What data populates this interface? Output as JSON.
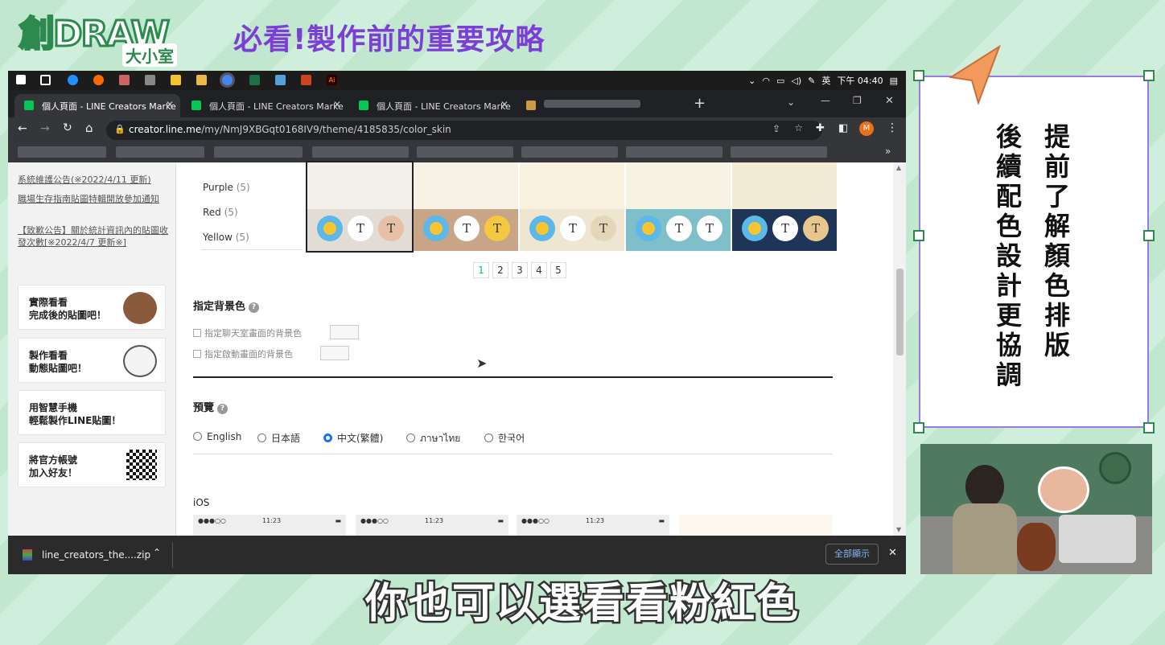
{
  "brand": {
    "logo_main": "創DRAW",
    "logo_sub": "大小室"
  },
  "headline": "必看!製作前的重要攻略",
  "taskbar": {
    "ime": "英",
    "clock": "下午 04:40",
    "app_label": "Ai"
  },
  "tabs": [
    {
      "label": "個人頁面 - LINE Creators Marke"
    },
    {
      "label": "個人頁面 - LINE Creators Marke"
    },
    {
      "label": "個人頁面 - LINE Creators Marke"
    }
  ],
  "addressbar": {
    "url_host": "creator.line.me",
    "url_path": "/my/NmJ9XBGqt0168IV9/theme/4185835/color_skin",
    "profile_initial": "M"
  },
  "sidebar": {
    "news": [
      "系統維護公告(※2022/4/11 更新)",
      "職場生存指南貼圖特輯開放參加通知",
      "【致歉公告】關於統計資訊內的貼圖收發次數[※2022/4/7 更新※]"
    ],
    "cards": [
      {
        "line1": "實際看看",
        "line2": "完成後的貼圖吧！"
      },
      {
        "line1": "製作看看",
        "line2": "動態貼圖吧！"
      },
      {
        "line1": "用智慧手機",
        "line2": "輕鬆製作LINE貼圖！"
      },
      {
        "line1": "將官方帳號",
        "line2": "加入好友！"
      }
    ]
  },
  "categories": [
    {
      "name": "Purple",
      "count": "(5)"
    },
    {
      "name": "Red",
      "count": "(5)"
    },
    {
      "name": "Yellow",
      "count": "(5)"
    }
  ],
  "themes": [
    {
      "top": "#f3f0ea",
      "bottom": "#e2ddd4",
      "c1": "#ffffff",
      "c2": "#e8c0a8",
      "t": "T"
    },
    {
      "top": "#f7f1e6",
      "bottom": "#c8a586",
      "c1": "#ffffff",
      "c2": "#f5c842",
      "t": "T"
    },
    {
      "top": "#f8f1e0",
      "bottom": "#efe6d2",
      "c1": "#ffffff",
      "c2": "#e4d6b8",
      "t": "T"
    },
    {
      "top": "#f6f2e4",
      "bottom": "#7fbfc9",
      "c1": "#ffffff",
      "c2": "#ffffff",
      "t": "T"
    },
    {
      "top": "#f3ead3",
      "bottom": "#1e3557",
      "c1": "#ffffff",
      "c2": "#e7c78d",
      "t": "T"
    }
  ],
  "pagination": [
    "1",
    "2",
    "3",
    "4",
    "5"
  ],
  "background_section": {
    "title": "指定背景色",
    "help": "?",
    "option1": "指定聊天室畫面的背景色",
    "option2": "指定啟動畫面的背景色"
  },
  "preview_section": {
    "title": "預覽",
    "help": "?",
    "languages": [
      "English",
      "日本語",
      "中文(繁體)",
      "ภาษาไทย",
      "한국어"
    ],
    "selected": "中文(繁體)",
    "platform": "iOS",
    "phone_time": "11:23"
  },
  "download": {
    "filename": "line_creators_the....zip",
    "show_all": "全部顯示"
  },
  "note": {
    "col1": "提前了解顏色排版",
    "col2": "後續配色設計更協調"
  },
  "subtitle": "你也可以選看看粉紅色",
  "colors": {
    "headline": "#7b3fd6",
    "note_border": "#9b7be0",
    "handle": "#2c8a4f",
    "selected_radio": "#1a73e8"
  }
}
